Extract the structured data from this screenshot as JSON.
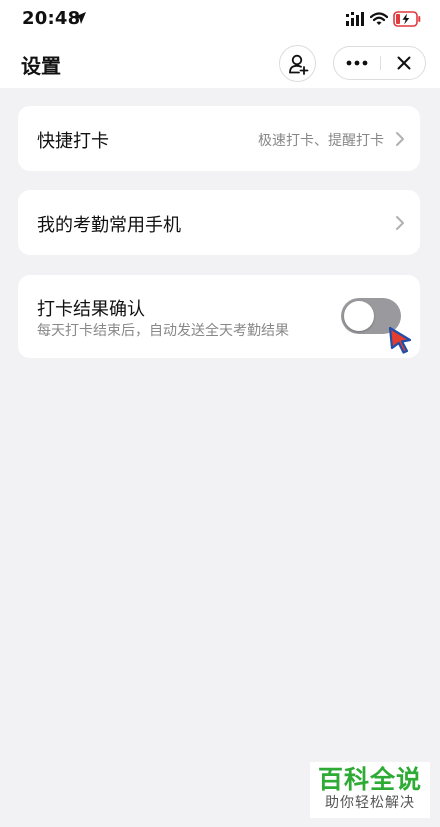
{
  "status_bar": {
    "time": "20:48",
    "icons": [
      "location-arrow-icon",
      "cellular-signal-icon",
      "wifi-icon",
      "battery-charging-icon"
    ],
    "battery_color": "#e0393e"
  },
  "nav": {
    "title": "设置",
    "icons": [
      "add-user-icon",
      "more-icon",
      "close-icon"
    ]
  },
  "settings": {
    "quick_punch": {
      "label": "快捷打卡",
      "hint": "极速打卡、提醒打卡"
    },
    "common_phone": {
      "label": "我的考勤常用手机"
    },
    "punch_confirm": {
      "label": "打卡结果确认",
      "description": "每天打卡结束后，自动发送全天考勤结果",
      "enabled": false
    }
  },
  "watermark": {
    "title": "百科全说",
    "subtitle": "助你轻松解决",
    "color": "#2eab35"
  },
  "colors": {
    "page_bg": "#f2f2f4",
    "card_bg": "#ffffff",
    "toggle_off": "#9a9a9e",
    "hint_text": "#888888"
  }
}
